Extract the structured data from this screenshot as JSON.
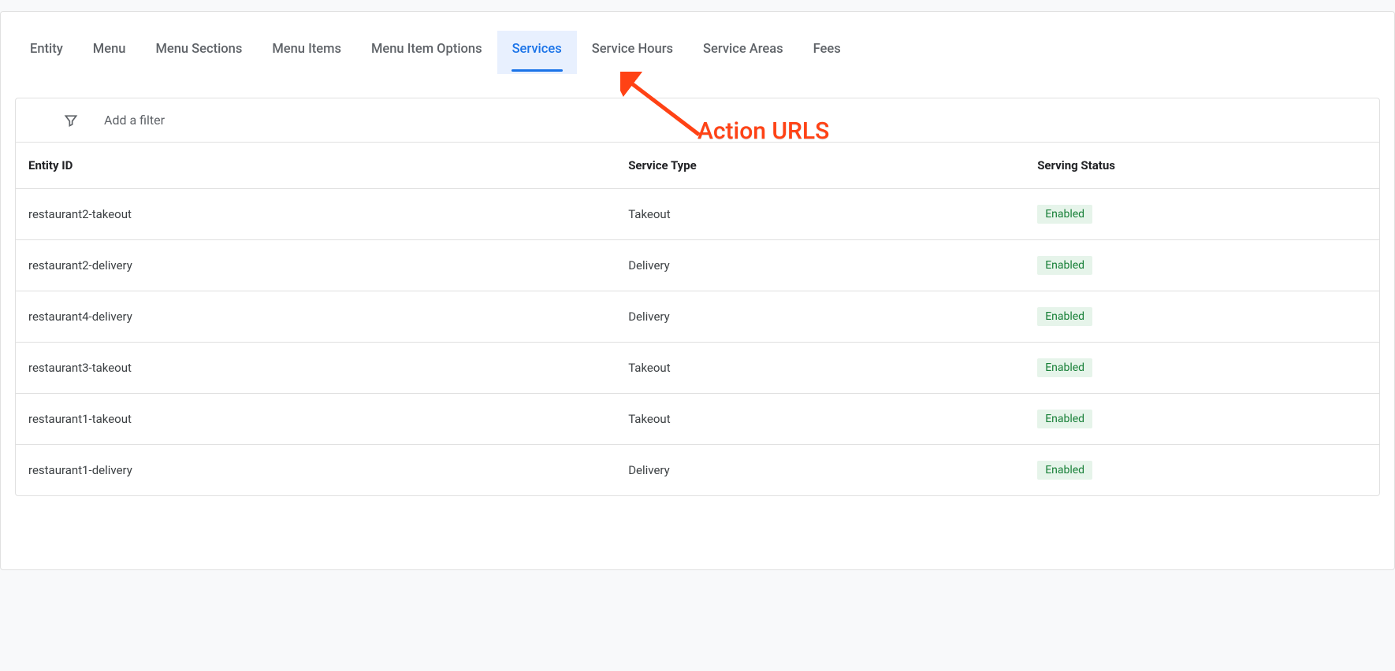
{
  "tabs": [
    {
      "label": "Entity",
      "active": false
    },
    {
      "label": "Menu",
      "active": false
    },
    {
      "label": "Menu Sections",
      "active": false
    },
    {
      "label": "Menu Items",
      "active": false
    },
    {
      "label": "Menu Item Options",
      "active": false
    },
    {
      "label": "Services",
      "active": true
    },
    {
      "label": "Service Hours",
      "active": false
    },
    {
      "label": "Service Areas",
      "active": false
    },
    {
      "label": "Fees",
      "active": false
    }
  ],
  "filter": {
    "placeholder": "Add a filter"
  },
  "table": {
    "headers": {
      "entity_id": "Entity ID",
      "service_type": "Service Type",
      "serving_status": "Serving Status"
    },
    "rows": [
      {
        "entity_id": "restaurant2-takeout",
        "service_type": "Takeout",
        "serving_status": "Enabled"
      },
      {
        "entity_id": "restaurant2-delivery",
        "service_type": "Delivery",
        "serving_status": "Enabled"
      },
      {
        "entity_id": "restaurant4-delivery",
        "service_type": "Delivery",
        "serving_status": "Enabled"
      },
      {
        "entity_id": "restaurant3-takeout",
        "service_type": "Takeout",
        "serving_status": "Enabled"
      },
      {
        "entity_id": "restaurant1-takeout",
        "service_type": "Takeout",
        "serving_status": "Enabled"
      },
      {
        "entity_id": "restaurant1-delivery",
        "service_type": "Delivery",
        "serving_status": "Enabled"
      }
    ]
  },
  "annotation": {
    "label": "Action URLS",
    "color": "#ff4215"
  }
}
